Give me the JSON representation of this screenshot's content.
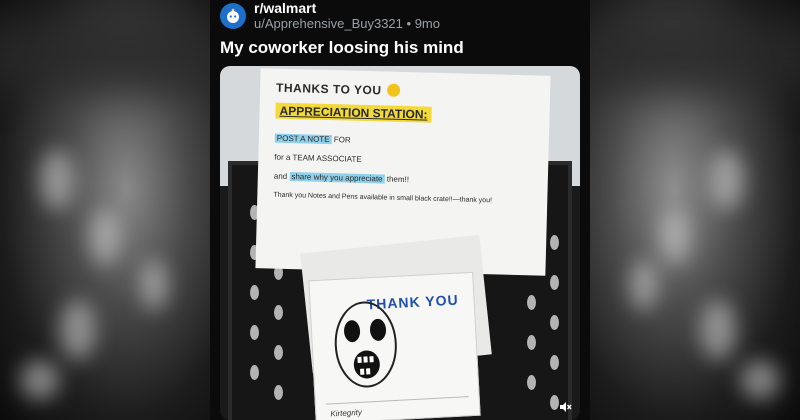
{
  "post": {
    "subreddit": "r/walmart",
    "username": "u/Apprehensive_Buy3321",
    "separator": "•",
    "age": "9mo",
    "title": "My coworker loosing his mind"
  },
  "photo": {
    "sign": {
      "line1": "THANKS TO YOU",
      "line2": "APPRECIATION STATION:",
      "line3_highlight": "POST A NOTE",
      "line3_rest": " FOR",
      "line4": "for a TEAM ASSOCIATE",
      "line5_pre": "and ",
      "line5_highlight": "share why you appreciate",
      "line5_post": " them!!",
      "line6": "Thank you Notes and Pens available in small black crate!!—thank you!"
    },
    "note": {
      "thank_text": "THANK YOU",
      "signature": "Kirtegrity"
    }
  },
  "icons": {
    "subreddit_avatar": "walmart-snoo-icon",
    "mute": "muted-speaker-icon",
    "emoji": "smiley-emoji-icon"
  },
  "colors": {
    "avatar_bg": "#1d6fc9",
    "sign_highlight_yellow": "#f3d93a",
    "sign_highlight_blue": "#8fd0ea"
  }
}
